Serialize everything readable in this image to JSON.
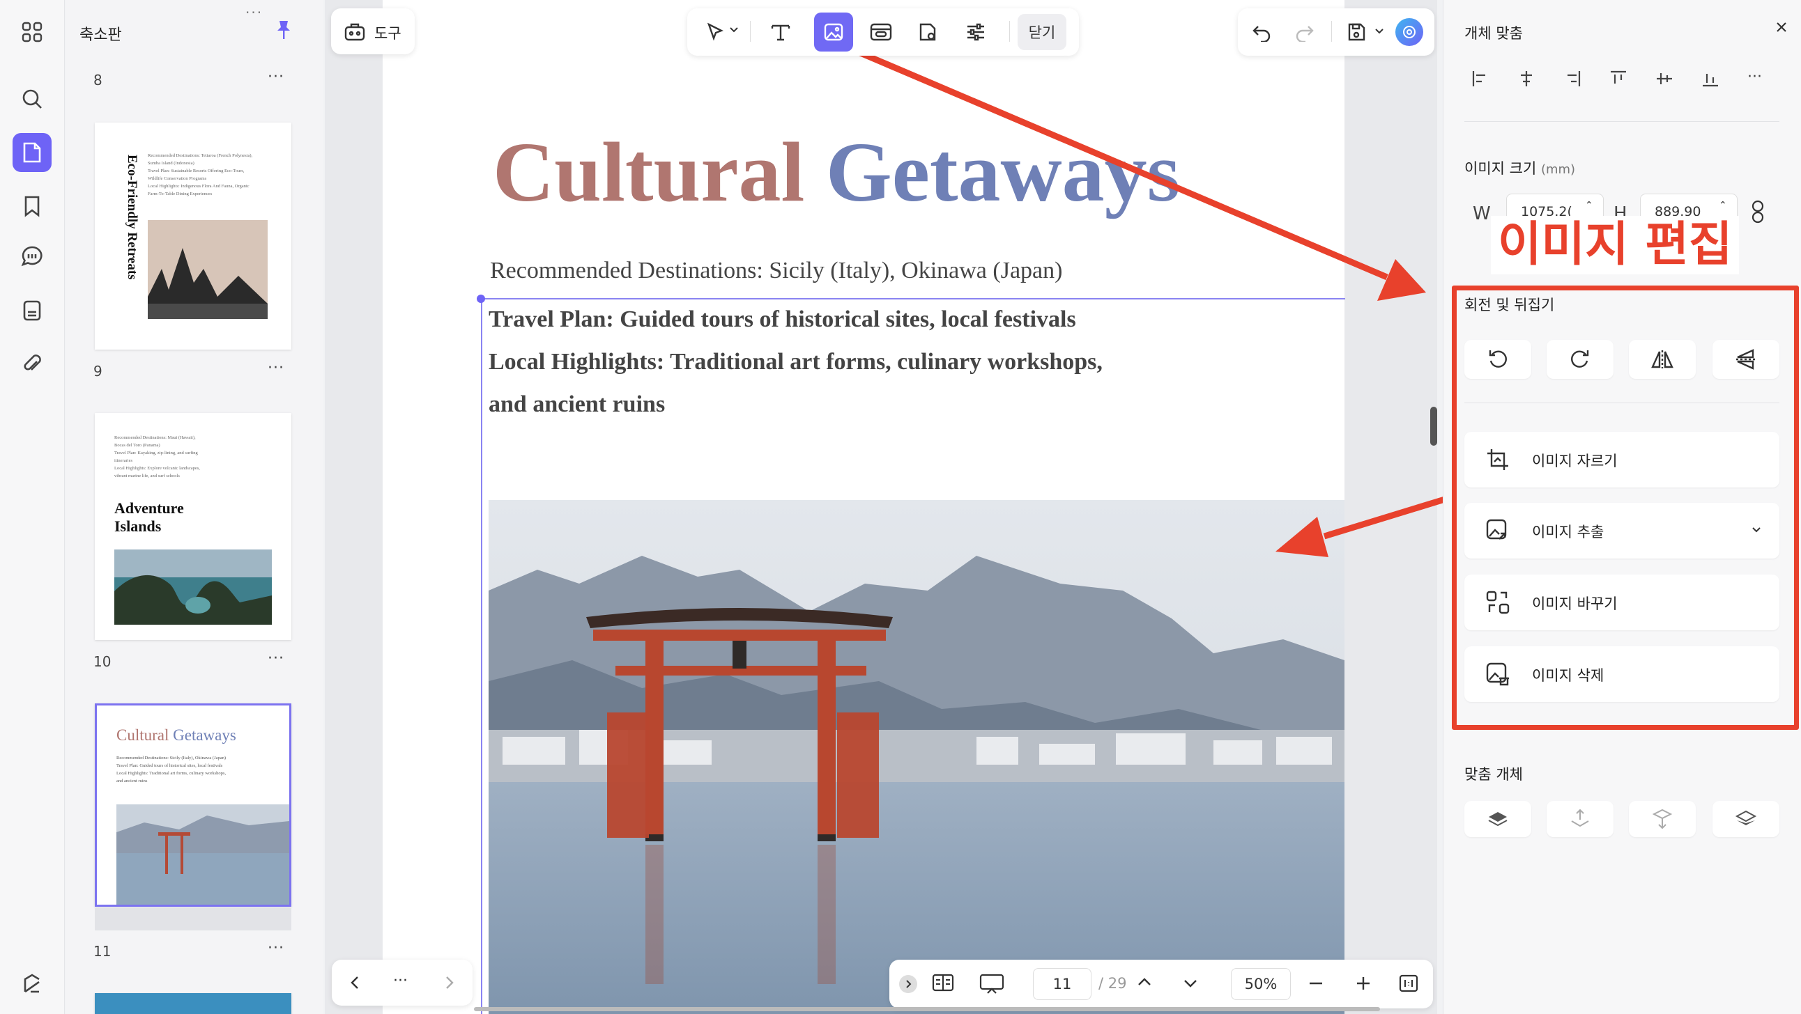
{
  "thumbnail_panel": {
    "title": "축소판",
    "pages": [
      {
        "number": "8"
      },
      {
        "number": "9",
        "vertical_title": "Eco-Friendly Retreats",
        "lines": [
          "Recommended Destinations: Tetiaroa (French Polynesia),",
          "Sumba Island (Indonesia)",
          "Travel Plan: Sustainable Resorts Offering Eco-Tours,",
          "Wildlife Conservation Programs",
          "Local Highlights: Indigenous Flora And Fauna, Organic",
          "Farm-To-Table Dining Experiences"
        ]
      },
      {
        "number": "10",
        "title": "Adventure Islands",
        "lines": [
          "Recommended Destinations: Maui (Hawaii),",
          "Bocas del Toro (Panama)",
          "Travel Plan: Kayaking, zip-lining, and surfing",
          "itineraries",
          "Local Highlights: Explore volcanic landscapes,",
          "vibrant marine life, and surf schools"
        ]
      },
      {
        "number": "11",
        "title_a": "Cultural",
        "title_b": "Getaways",
        "lines": [
          "Recommended Destinations: Sicily (Italy), Okinawa (Japan)",
          "Travel Plan: Guided tours of historical sites, local festivals",
          "Local Highlights: Traditional art forms, culinary workshops,",
          "and ancient ruins"
        ]
      }
    ]
  },
  "toolbar": {
    "tools_label": "도구",
    "close_label": "닫기"
  },
  "document": {
    "title_a": "Cultural",
    "title_b": "Getaways",
    "recommended": "Recommended Destinations: Sicily (Italy), Okinawa (Japan)",
    "lines": [
      "Travel Plan: Guided tours of historical sites, local festivals",
      "Local Highlights: Traditional art forms, culinary workshops,",
      "and ancient ruins"
    ]
  },
  "bottom_bar": {
    "more": "···",
    "page_current": "11",
    "page_total": "/ 29",
    "zoom": "50%"
  },
  "right_panel": {
    "align_title": "개체 맞춤",
    "size_title": "이미지 크기",
    "size_unit": "(mm)",
    "w_label": "W",
    "w_value": "1075.2(",
    "h_label": "H",
    "h_value": "889.90",
    "annotation": "이미지 편집",
    "rotate_title": "회전 및 뒤집기",
    "actions": [
      "이미지 자르기",
      "이미지 추출",
      "이미지 바꾸기",
      "이미지 삭제"
    ],
    "arrange_title": "맞춤 개체"
  },
  "colors": {
    "accent": "#6e63f6",
    "annotation_red": "#e8412c",
    "title_red": "#b07670",
    "title_blue": "#6f80b6"
  }
}
